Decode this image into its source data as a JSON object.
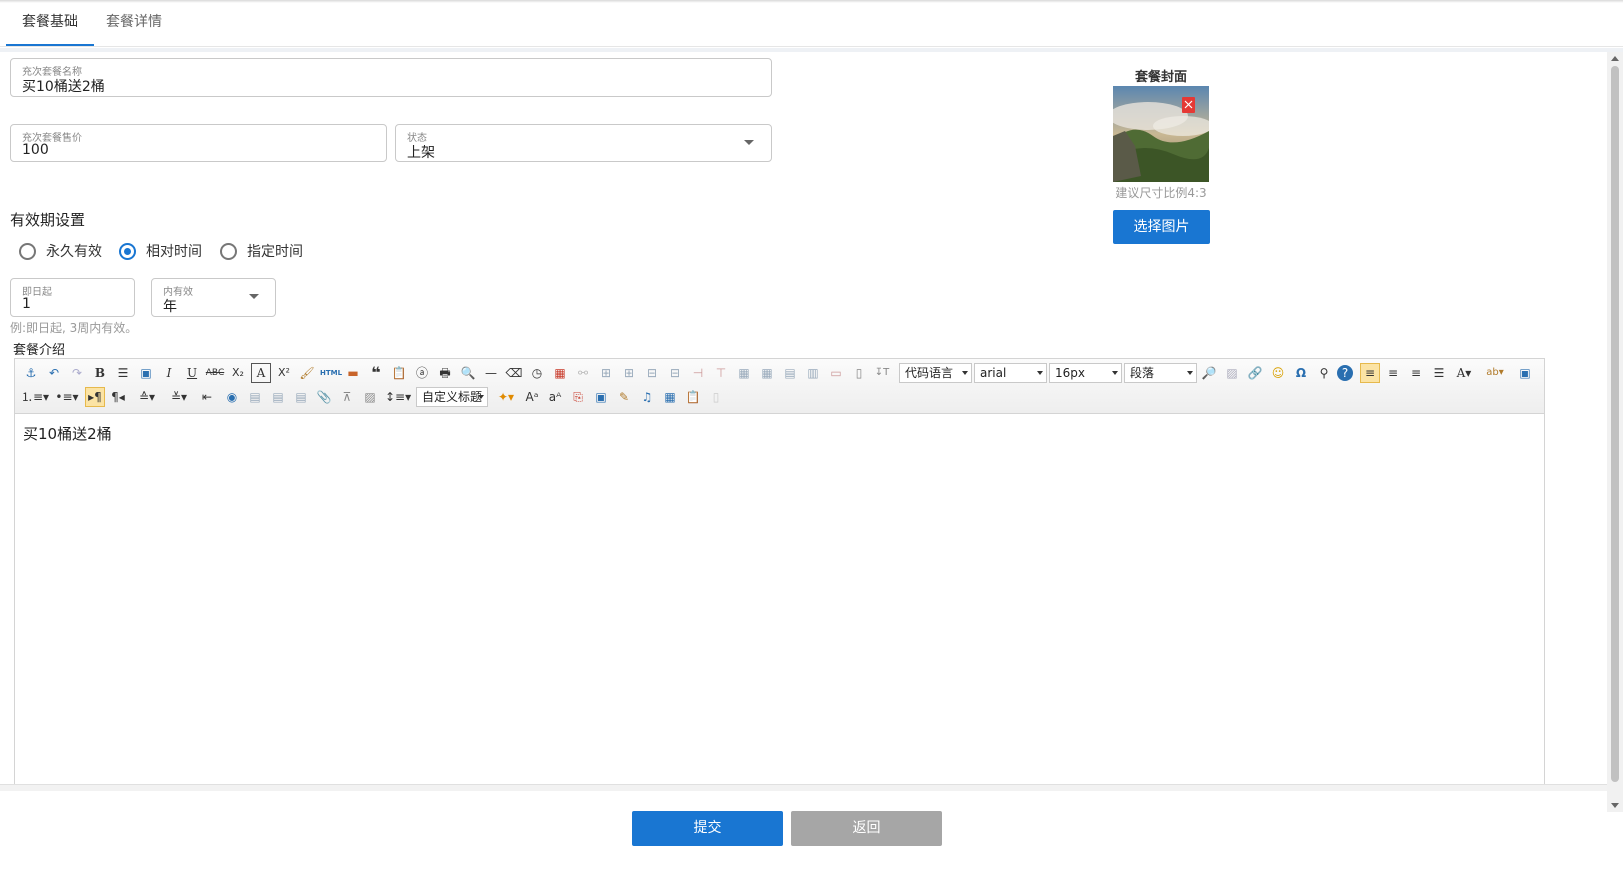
{
  "tabs": [
    {
      "label": "套餐基础"
    },
    {
      "label": "套餐详情"
    }
  ],
  "form": {
    "name": {
      "label": "充次套餐名称",
      "value": "买10桶送2桶"
    },
    "price": {
      "label": "充次套餐售价",
      "value": "100"
    },
    "status": {
      "label": "状态",
      "value": "上架"
    }
  },
  "validity": {
    "title": "有效期设置",
    "options": [
      {
        "label": "永久有效",
        "checked": false
      },
      {
        "label": "相对时间",
        "checked": true
      },
      {
        "label": "指定时间",
        "checked": false
      }
    ],
    "start": {
      "label": "即日起",
      "value": "1"
    },
    "unit": {
      "label": "内有效",
      "value": "年"
    },
    "hint": "例:即日起, 3周内有效。"
  },
  "intro": {
    "title": "套餐介绍",
    "toolbar": {
      "code_lang": "代码语言",
      "font": "arial",
      "size": "16px",
      "paragraph": "段落",
      "custom_title": "自定义标题"
    },
    "content": "买10桶送2桶"
  },
  "cover": {
    "title": "套餐封面",
    "hint": "建议尺寸比例4:3",
    "select_label": "选择图片"
  },
  "actions": {
    "submit": "提交",
    "back": "返回"
  },
  "colors": {
    "primary": "#1976d2",
    "secondary": "#a6a6a6"
  }
}
